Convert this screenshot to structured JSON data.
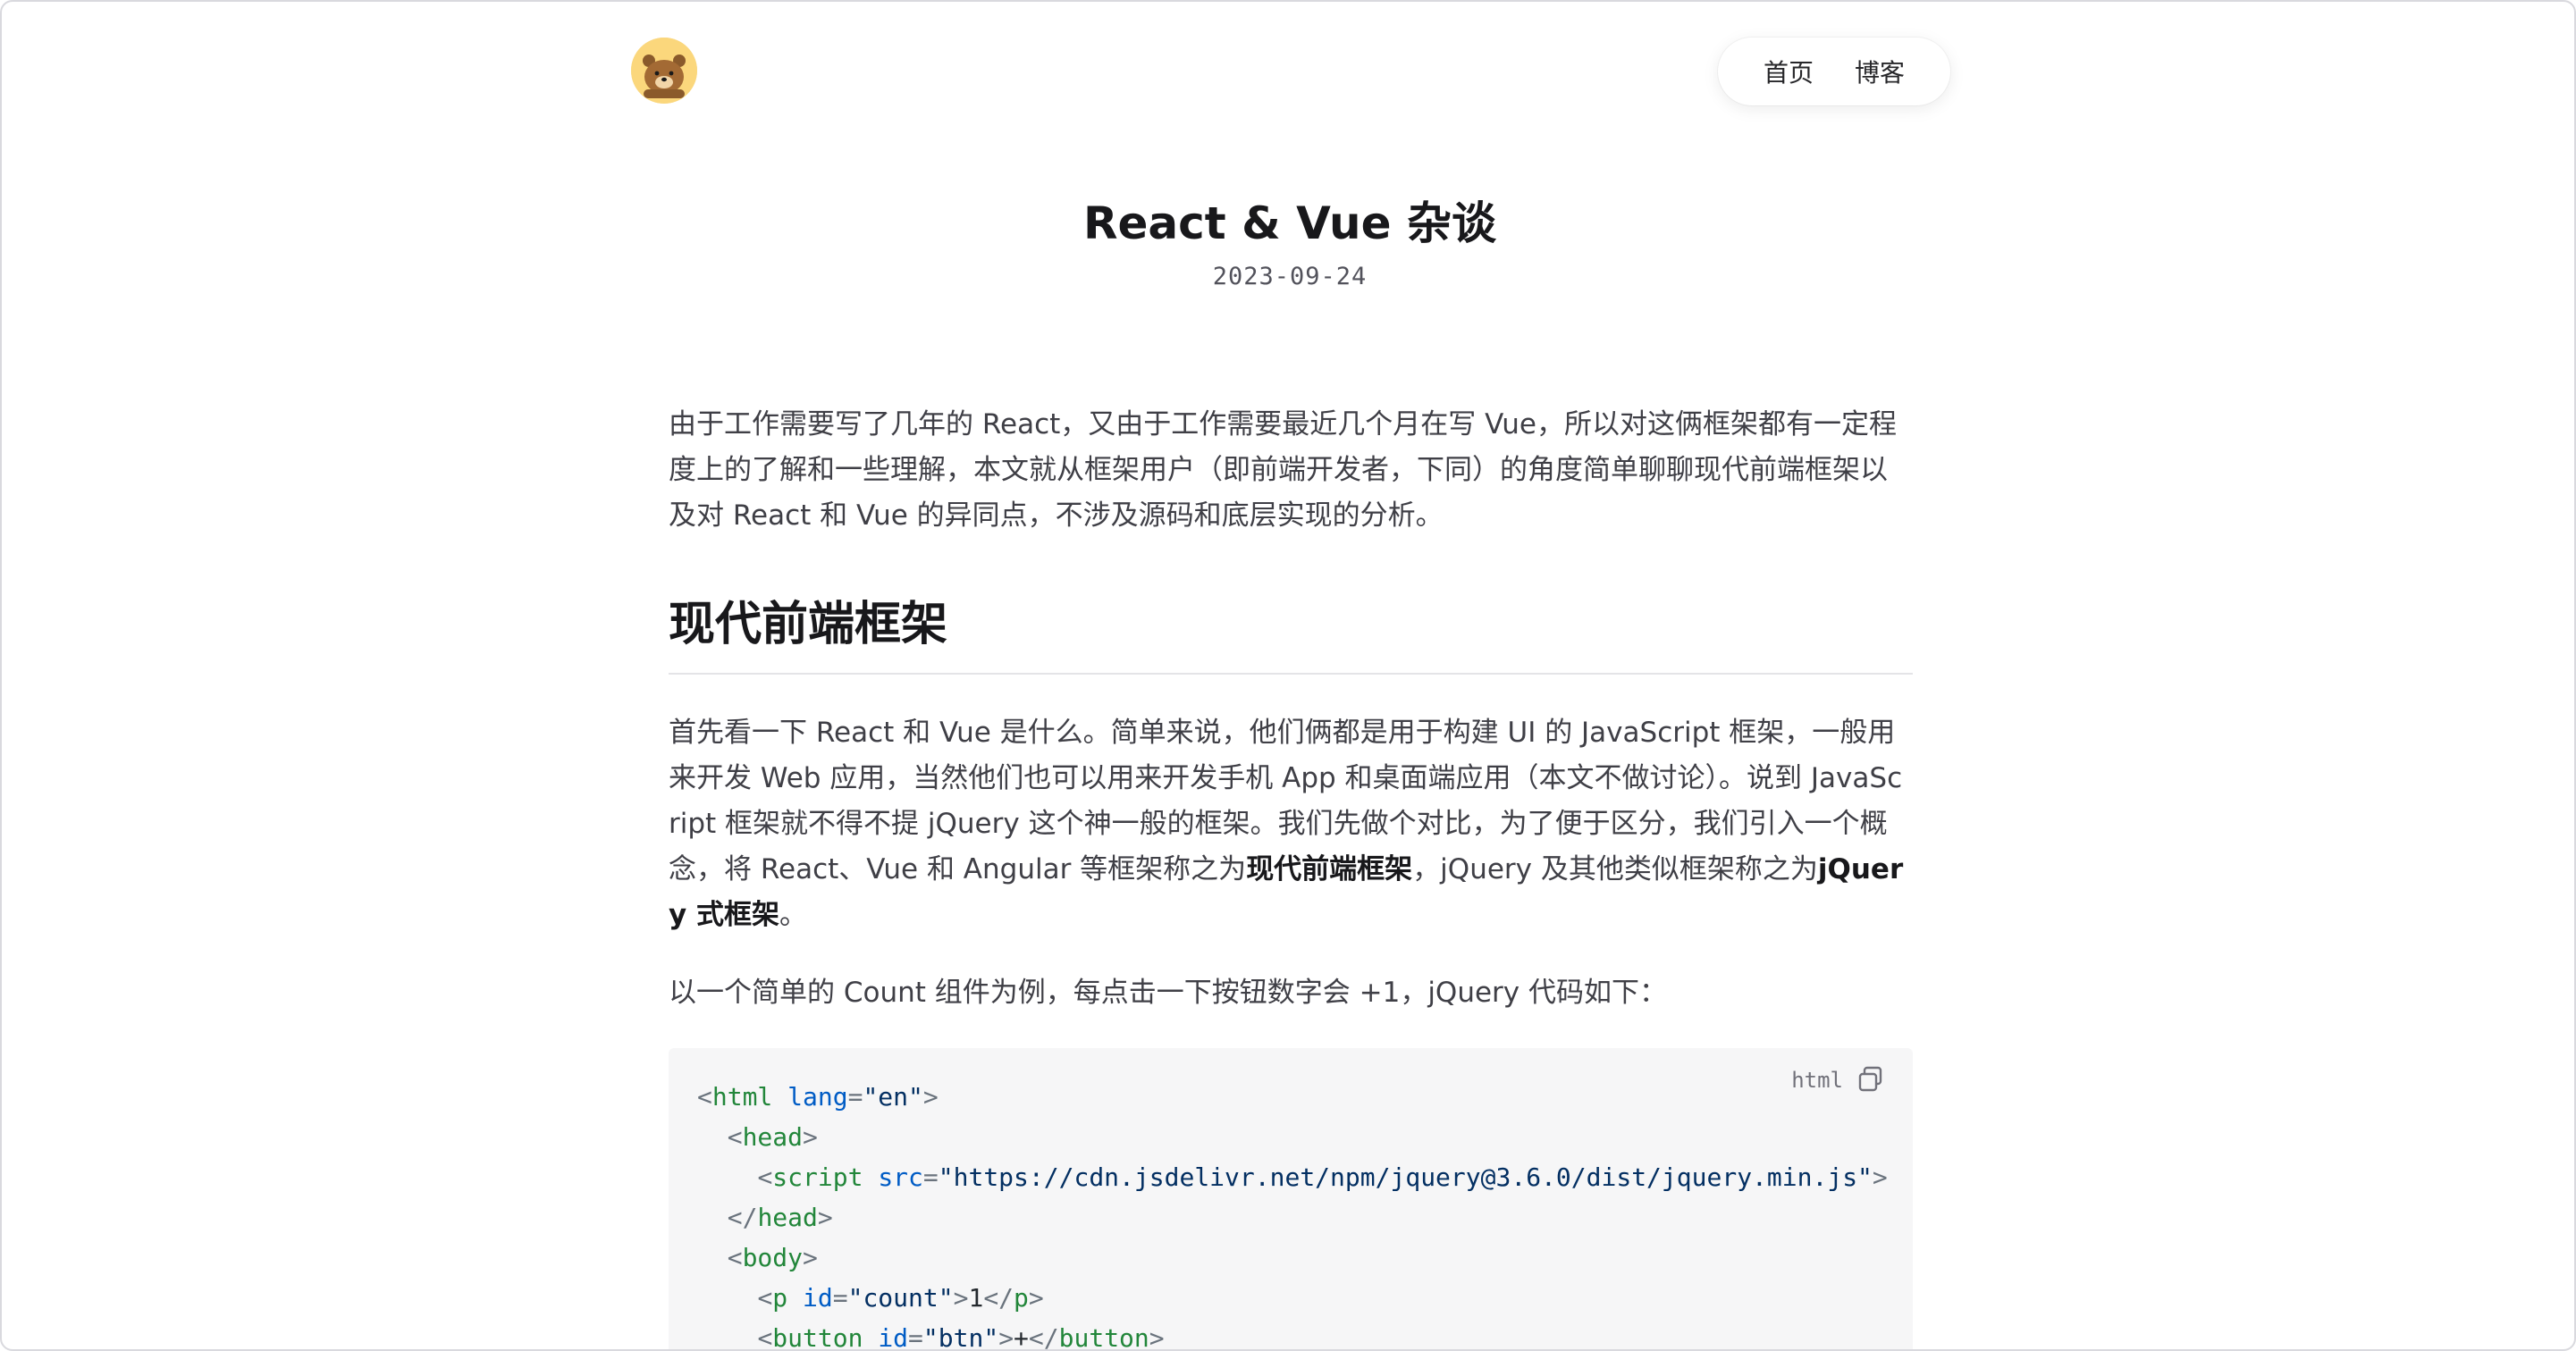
{
  "nav": {
    "home": "首页",
    "blog": "博客"
  },
  "article": {
    "title": "React & Vue 杂谈",
    "date": "2023-09-24",
    "intro": "由于工作需要写了几年的 React，又由于工作需要最近几个月在写 Vue，所以对这俩框架都有一定程度上的了解和一些理解，本文就从框架用户（即前端开发者，下同）的角度简单聊聊现代前端框架以及对 React 和 Vue 的异同点，不涉及源码和底层实现的分析。",
    "section_heading": "现代前端框架",
    "para2_a": "首先看一下 React 和 Vue 是什么。简单来说，他们俩都是用于构建 UI 的 JavaScript 框架，一般用来开发 Web 应用，当然他们也可以用来开发手机 App 和桌面端应用（本文不做讨论）。说到 JavaScript 框架就不得不提 jQuery 这个神一般的框架。我们先做个对比，为了便于区分，我们引入一个概念，将 React、Vue 和 Angular 等框架称之为",
    "para2_b1": "现代前端框架",
    "para2_c": "，jQuery 及其他类似框架称之为",
    "para2_b2": "jQuery 式框架",
    "para2_d": "。",
    "para3": "以一个简单的 Count 组件为例，每点击一下按钮数字会 +1，jQuery 代码如下："
  },
  "code_block": {
    "language": "html",
    "lines": [
      {
        "i": "",
        "parts": [
          [
            "pu",
            "<"
          ],
          [
            "tg",
            "html"
          ],
          [
            "t",
            " "
          ],
          [
            "at",
            "lang"
          ],
          [
            "pu",
            "="
          ],
          [
            "st",
            "\"en\""
          ],
          [
            "pu",
            ">"
          ]
        ]
      },
      {
        "i": "  ",
        "parts": [
          [
            "pu",
            "<"
          ],
          [
            "tg",
            "head"
          ],
          [
            "pu",
            ">"
          ]
        ]
      },
      {
        "i": "    ",
        "parts": [
          [
            "pu",
            "<"
          ],
          [
            "tg",
            "script"
          ],
          [
            "t",
            " "
          ],
          [
            "at",
            "src"
          ],
          [
            "pu",
            "="
          ],
          [
            "st",
            "\"https://cdn.jsdelivr.net/npm/jquery@3.6.0/dist/jquery.min.js\""
          ],
          [
            "pu",
            ">"
          ]
        ]
      },
      {
        "i": "  ",
        "parts": [
          [
            "pu",
            "</"
          ],
          [
            "tg",
            "head"
          ],
          [
            "pu",
            ">"
          ]
        ]
      },
      {
        "i": "  ",
        "parts": [
          [
            "pu",
            "<"
          ],
          [
            "tg",
            "body"
          ],
          [
            "pu",
            ">"
          ]
        ]
      },
      {
        "i": "    ",
        "parts": [
          [
            "pu",
            "<"
          ],
          [
            "tg",
            "p"
          ],
          [
            "t",
            " "
          ],
          [
            "at",
            "id"
          ],
          [
            "pu",
            "="
          ],
          [
            "st",
            "\"count\""
          ],
          [
            "pu",
            ">"
          ],
          [
            "t",
            "1"
          ],
          [
            "pu",
            "</"
          ],
          [
            "tg",
            "p"
          ],
          [
            "pu",
            ">"
          ]
        ]
      },
      {
        "i": "    ",
        "parts": [
          [
            "pu",
            "<"
          ],
          [
            "tg",
            "button"
          ],
          [
            "t",
            " "
          ],
          [
            "at",
            "id"
          ],
          [
            "pu",
            "="
          ],
          [
            "st",
            "\"btn\""
          ],
          [
            "pu",
            ">"
          ],
          [
            "t",
            "+"
          ],
          [
            "pu",
            "</"
          ],
          [
            "tg",
            "button"
          ],
          [
            "pu",
            ">"
          ]
        ]
      }
    ]
  }
}
